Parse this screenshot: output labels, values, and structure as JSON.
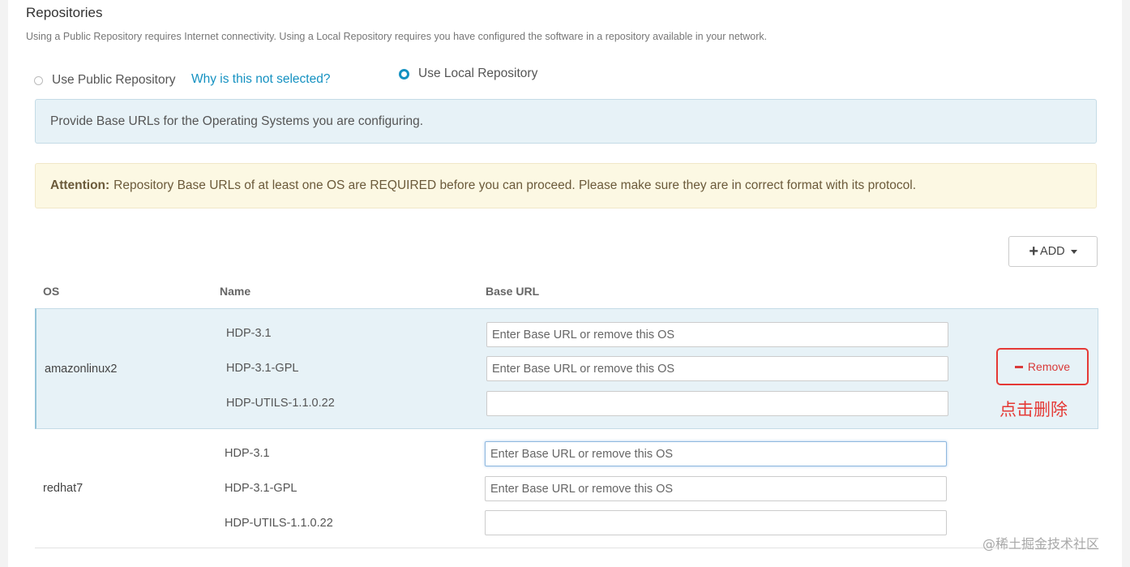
{
  "section": {
    "title": "Repositories",
    "description": "Using a Public Repository requires Internet connectivity. Using a Local Repository requires you have configured the software in a repository available in your network."
  },
  "repo_options": {
    "public_label": "Use Public Repository",
    "why_link": "Why is this not selected?",
    "local_label": "Use Local Repository",
    "selected": "local"
  },
  "info_alert": "Provide Base URLs for the Operating Systems you are configuring.",
  "warning_alert": {
    "label": "Attention:",
    "text": "Repository Base URLs of at least one OS are REQUIRED before you can proceed. Please make sure they are in correct format with its protocol."
  },
  "add_button": {
    "label": "ADD"
  },
  "table": {
    "headers": {
      "os": "OS",
      "name": "Name",
      "base_url": "Base URL"
    },
    "os_groups": [
      {
        "os": "amazonlinux2",
        "repos": [
          {
            "name": "HDP-3.1",
            "placeholder": "Enter Base URL or remove this OS",
            "value": ""
          },
          {
            "name": "HDP-3.1-GPL",
            "placeholder": "Enter Base URL or remove this OS",
            "value": ""
          },
          {
            "name": "HDP-UTILS-1.1.0.22",
            "placeholder": "",
            "value": ""
          }
        ],
        "remove_label": "Remove",
        "annotation": "点击删除"
      },
      {
        "os": "redhat7",
        "repos": [
          {
            "name": "HDP-3.1",
            "placeholder": "Enter Base URL or remove this OS",
            "value": ""
          },
          {
            "name": "HDP-3.1-GPL",
            "placeholder": "Enter Base URL or remove this OS",
            "value": ""
          },
          {
            "name": "HDP-UTILS-1.1.0.22",
            "placeholder": "",
            "value": ""
          }
        ]
      }
    ]
  },
  "watermark": "@稀土掘金技术社区",
  "colors": {
    "accent": "#1491c1",
    "info_bg": "#e7f2f7",
    "warning_bg": "#fcf8e3",
    "annotation_red": "#e53935"
  }
}
